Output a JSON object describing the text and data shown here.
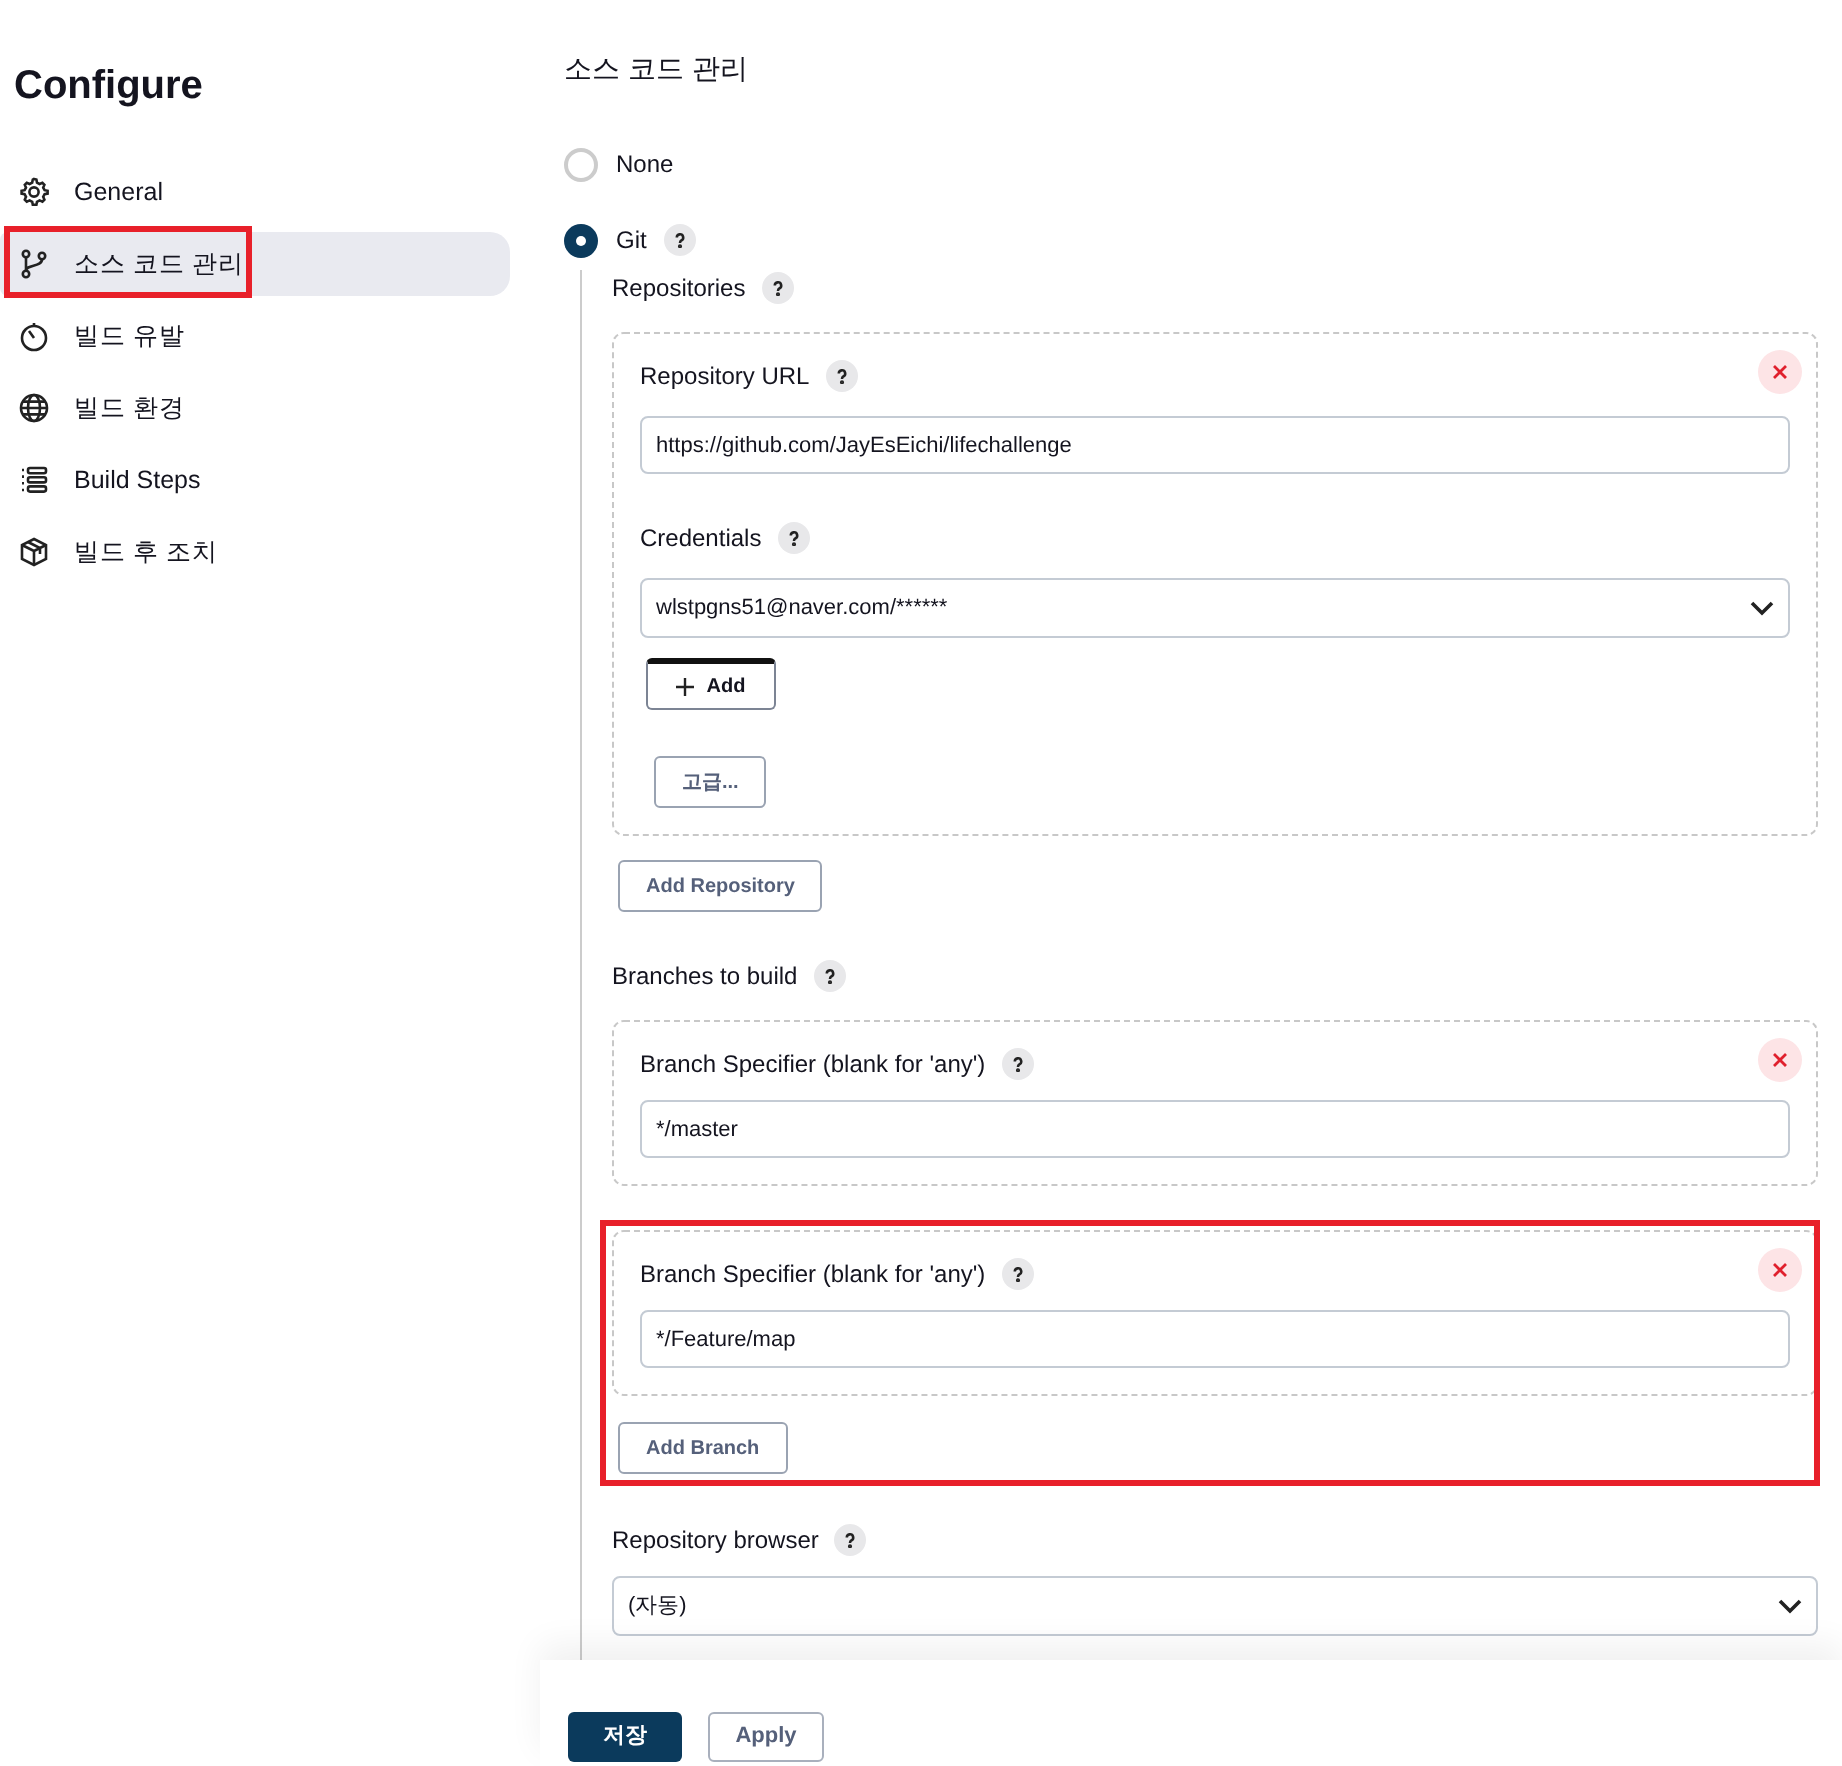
{
  "sidebar": {
    "title": "Configure",
    "items": [
      {
        "kind": "gear",
        "label": "General",
        "selected": false,
        "highlighted": false
      },
      {
        "kind": "branch",
        "label": "소스 코드 관리",
        "selected": true,
        "highlighted": true
      },
      {
        "kind": "timer",
        "label": "빌드 유발",
        "selected": false,
        "highlighted": false
      },
      {
        "kind": "globe",
        "label": "빌드 환경",
        "selected": false,
        "highlighted": false
      },
      {
        "kind": "list",
        "label": "Build Steps",
        "selected": false,
        "highlighted": false
      },
      {
        "kind": "package",
        "label": "빌드 후 조치",
        "selected": false,
        "highlighted": false
      }
    ]
  },
  "section_title": "소스 코드 관리",
  "scm_options": [
    {
      "label": "None",
      "selected": false,
      "help": false
    },
    {
      "label": "Git",
      "selected": true,
      "help": true
    }
  ],
  "repositories": {
    "label": "Repositories",
    "entries": [
      {
        "url_label": "Repository URL",
        "url": "https://github.com/JayEsEichi/lifechallenge",
        "credentials_label": "Credentials",
        "credentials": "wlstpgns51@naver.com/******",
        "add_button": "Add",
        "advanced_button": "고급..."
      }
    ],
    "add_button": "Add Repository"
  },
  "branches": {
    "label": "Branches to build",
    "entries": [
      {
        "label": "Branch Specifier (blank for 'any')",
        "value": "*/master",
        "highlighted": false
      },
      {
        "label": "Branch Specifier (blank for 'any')",
        "value": "*/Feature/map",
        "highlighted": true
      }
    ],
    "add_button": "Add Branch"
  },
  "repository_browser": {
    "label": "Repository browser",
    "value": "(자동)"
  },
  "footer": {
    "save_button": "저장",
    "apply_button": "Apply"
  }
}
